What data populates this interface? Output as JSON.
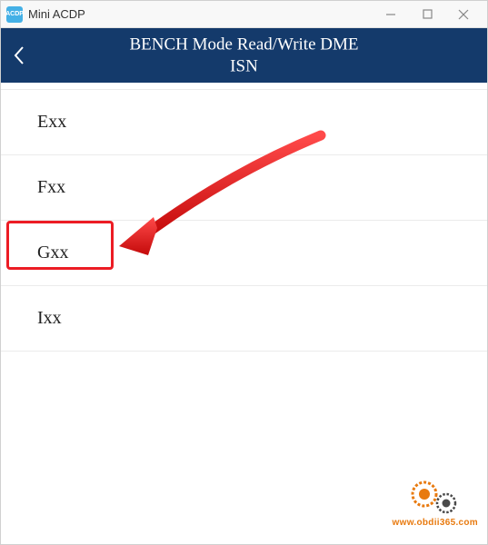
{
  "titlebar": {
    "app_name": "Mini ACDP"
  },
  "header": {
    "title_line1": "BENCH Mode Read/Write DME",
    "title_line2": "ISN"
  },
  "list": {
    "items": [
      {
        "label": "Exx"
      },
      {
        "label": "Fxx"
      },
      {
        "label": "Gxx"
      },
      {
        "label": "Ixx"
      }
    ]
  },
  "watermark": {
    "url": "www.obdii365.com"
  }
}
